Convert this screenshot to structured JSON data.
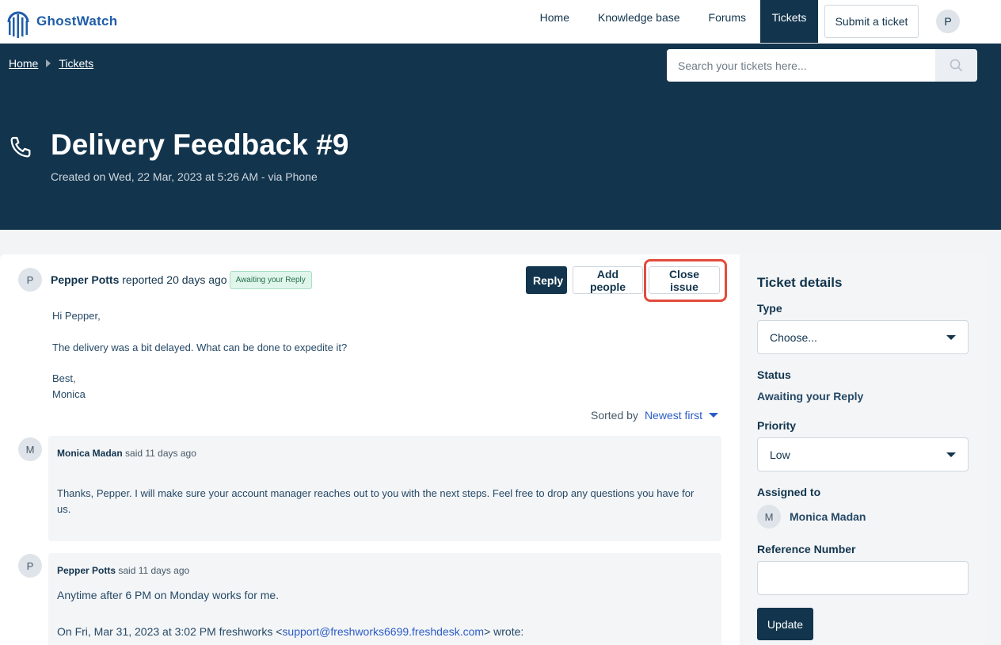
{
  "brand": {
    "name": "GhostWatch"
  },
  "nav": {
    "items": [
      {
        "label": "Home"
      },
      {
        "label": "Knowledge base"
      },
      {
        "label": "Forums"
      },
      {
        "label": "Tickets"
      }
    ],
    "submit_label": "Submit a ticket",
    "avatar_initial": "P"
  },
  "breadcrumb": {
    "home": "Home",
    "tickets": "Tickets"
  },
  "search": {
    "placeholder": "Search your tickets here..."
  },
  "ticket": {
    "title": "Delivery Feedback #9",
    "subtitle": "Created on Wed, 22 Mar, 2023 at 5:26 AM - via Phone",
    "reporter_initial": "P",
    "reporter_name": "Pepper Potts",
    "reported_text": "reported 20 days ago",
    "status_badge": "Awaiting your Reply",
    "body": [
      "Hi Pepper,",
      "The delivery was a bit delayed. What can be done to expedite it?",
      "Best,",
      "Monica"
    ]
  },
  "actions": {
    "reply": "Reply",
    "add_people": "Add people",
    "close_issue": "Close issue"
  },
  "sort": {
    "label": "Sorted by",
    "value": "Newest first"
  },
  "comments": [
    {
      "initial": "M",
      "author": "Monica Madan",
      "said": "said 11 days ago",
      "body": "Thanks, Pepper. I will make sure your account manager reaches out to you with the next steps. Feel free to drop any questions you have for us."
    },
    {
      "initial": "P",
      "author": "Pepper Potts",
      "said": "said 11 days ago",
      "body": "Anytime after 6 PM on Monday works for me.",
      "quote_prefix": "On Fri, Mar 31, 2023 at 3:02 PM freshworks <",
      "quote_email": "support@freshworks6699.freshdesk.com",
      "quote_suffix": "> wrote:"
    }
  ],
  "sidebar": {
    "title": "Ticket details",
    "type_label": "Type",
    "type_value": "Choose...",
    "status_label": "Status",
    "status_value": "Awaiting your Reply",
    "priority_label": "Priority",
    "priority_value": "Low",
    "assigned_label": "Assigned to",
    "assigned_initial": "M",
    "assigned_name": "Monica Madan",
    "reference_label": "Reference Number",
    "reference_value": "",
    "update_label": "Update"
  },
  "colors": {
    "navy": "#12344d",
    "highlight": "#e24c3c",
    "link": "#2c5cc5"
  }
}
